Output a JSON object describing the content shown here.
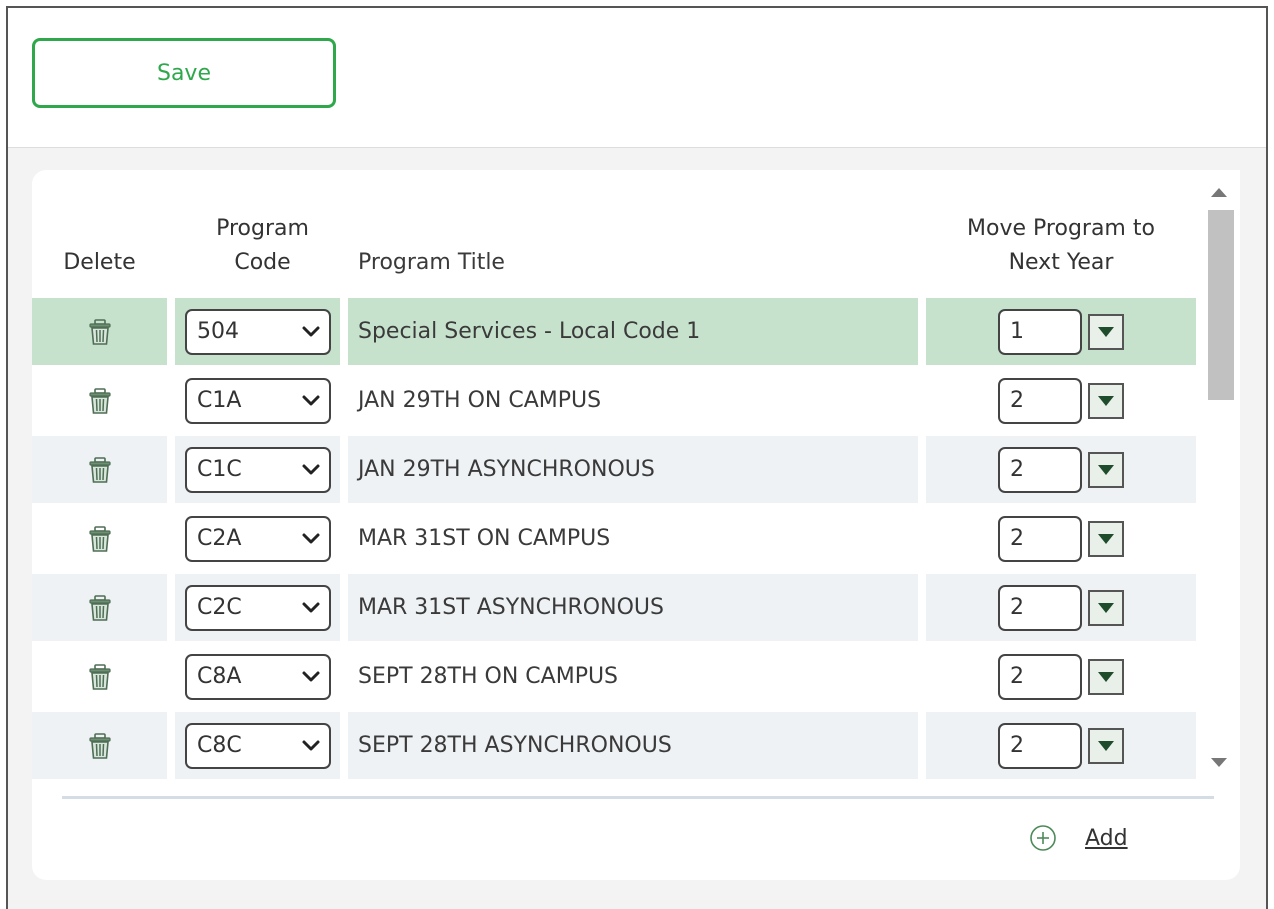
{
  "toolbar": {
    "save_label": "Save"
  },
  "table": {
    "headers": {
      "delete": "Delete",
      "program_code": "Program\nCode",
      "program_title": "Program Title",
      "move": "Move Program to\nNext Year"
    },
    "rows": [
      {
        "code": "504",
        "title": "Special Services - Local Code 1",
        "move": "1"
      },
      {
        "code": "C1A",
        "title": "JAN 29TH ON CAMPUS",
        "move": "2"
      },
      {
        "code": "C1C",
        "title": "JAN 29TH ASYNCHRONOUS",
        "move": "2"
      },
      {
        "code": "C2A",
        "title": "MAR 31ST ON CAMPUS",
        "move": "2"
      },
      {
        "code": "C2C",
        "title": "MAR 31ST ASYNCHRONOUS",
        "move": "2"
      },
      {
        "code": "C8A",
        "title": "SEPT 28TH ON CAMPUS",
        "move": "2"
      },
      {
        "code": "C8C",
        "title": "SEPT 28TH ASYNCHRONOUS",
        "move": "2"
      }
    ]
  },
  "footer": {
    "add_label": "Add"
  },
  "colors": {
    "accent_green": "#2ea84a",
    "selected_row": "#c7e2cc",
    "alt_row": "#eef2f4"
  },
  "icons": {
    "delete": "trash-icon",
    "add": "plus-circle-icon",
    "select": "chevron-down-icon",
    "move_dropdown": "dropdown-arrow-icon"
  }
}
